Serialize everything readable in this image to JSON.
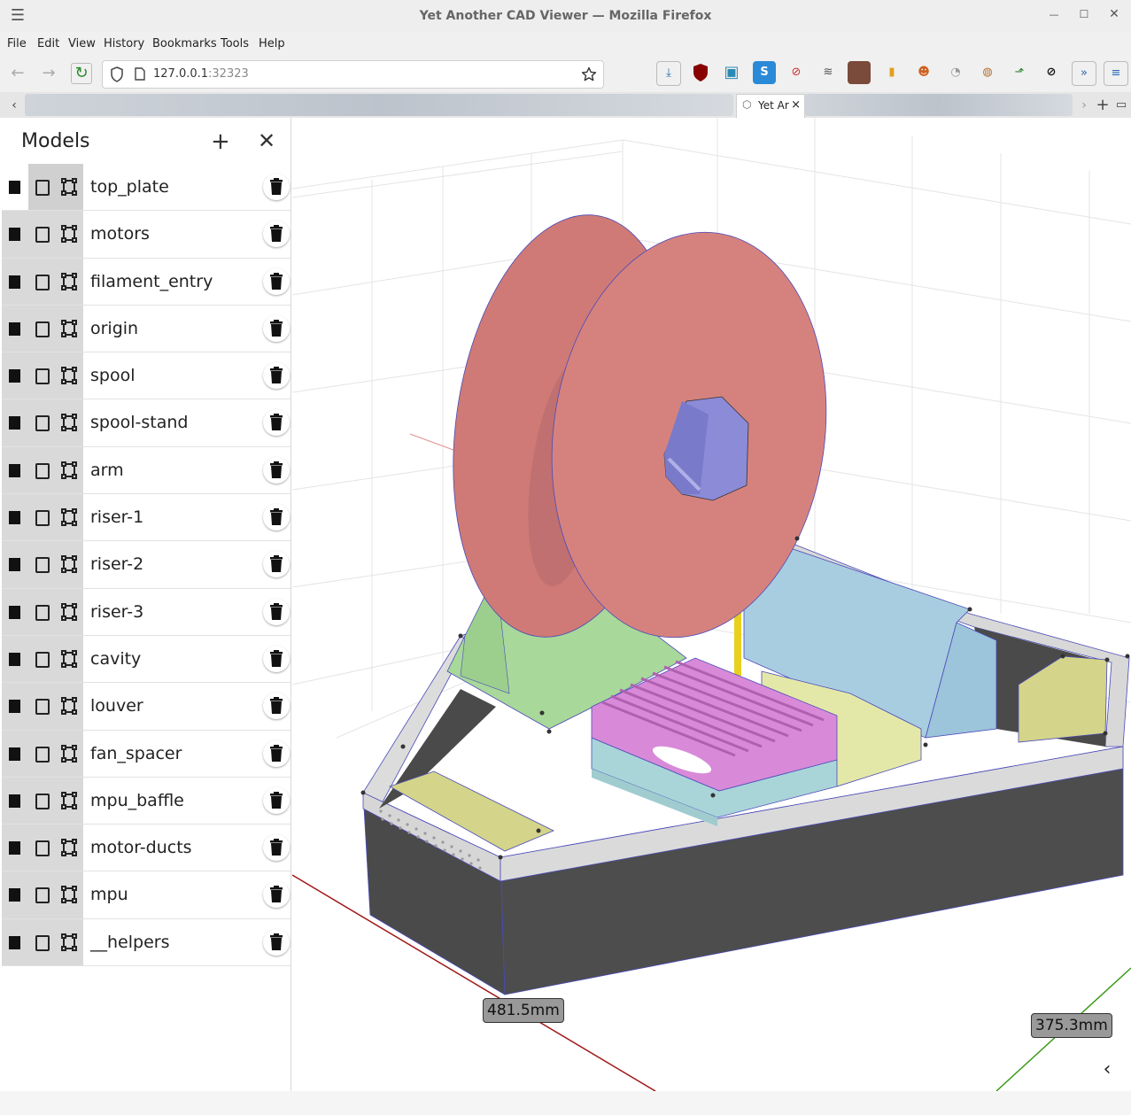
{
  "window": {
    "title": "Yet Another CAD Viewer — Mozilla Firefox",
    "minimize": "—",
    "maximize": "☐",
    "close": "✕"
  },
  "menu": [
    "File",
    "Edit",
    "View",
    "History",
    "Bookmarks",
    "Tools",
    "Help"
  ],
  "url": {
    "host": "127.0.0.1",
    "port": ":32323"
  },
  "tab": {
    "label": "Yet Ar",
    "close": "×"
  },
  "panel": {
    "title": "Models",
    "add": "+",
    "close": "✕",
    "models": [
      "top_plate",
      "motors",
      "filament_entry",
      "origin",
      "spool",
      "spool-stand",
      "arm",
      "riser-1",
      "riser-2",
      "riser-3",
      "cavity",
      "louver",
      "fan_spacer",
      "mpu_baffle",
      "motor-ducts",
      "mpu",
      "__helpers"
    ]
  },
  "dimensions": {
    "x": "481.5mm",
    "y": "375.3mm"
  },
  "collapse": "‹",
  "colors": {
    "spool": "#d5827f",
    "spool_hub": "#8b8bd8",
    "base_dark": "#4a4a4a",
    "base_top": "#d9d9d9",
    "stand_green": "#a8d89a",
    "duct_blue": "#a9cde0",
    "louver_pink": "#d88ad8",
    "khaki": "#d4d48a",
    "edge": "#4a4aba"
  }
}
